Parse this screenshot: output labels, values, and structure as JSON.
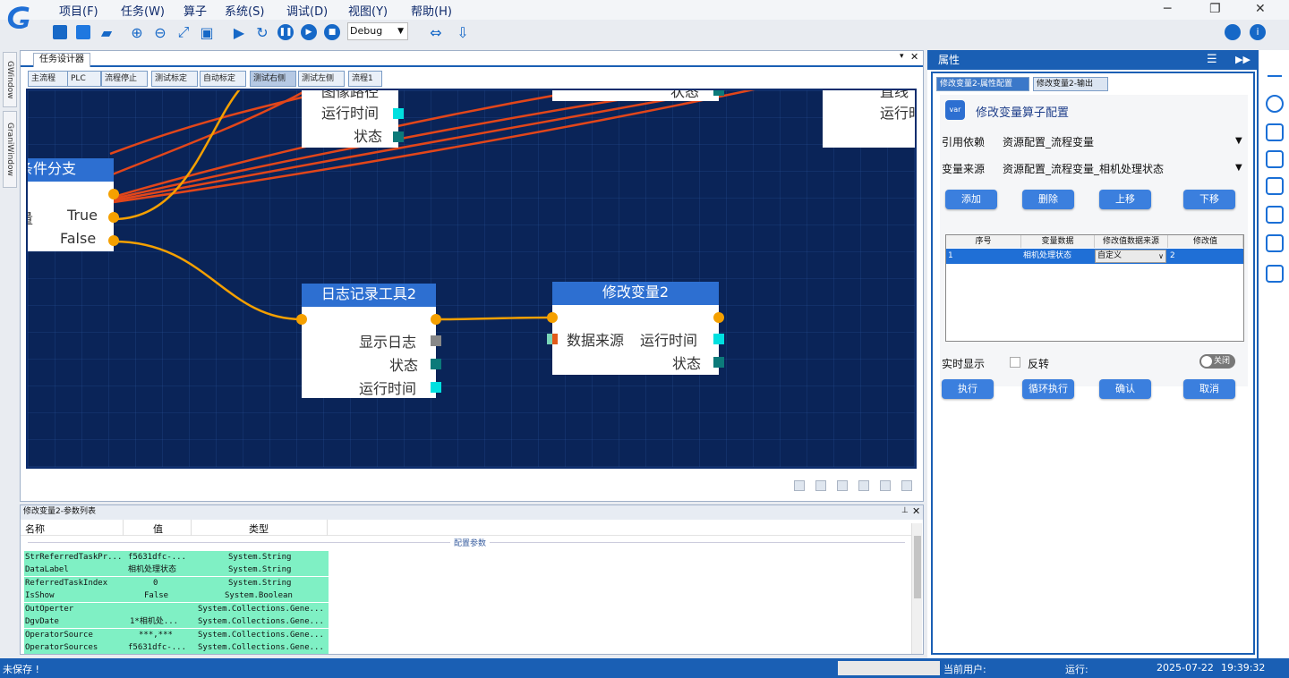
{
  "menu": {
    "items": [
      "项目(F)",
      "任务(W)",
      "算子",
      "系统(S)",
      "调试(D)",
      "视图(Y)",
      "帮助(H)"
    ]
  },
  "toolbar": {
    "mode_select": "Debug",
    "icons": [
      "save-icon",
      "new-icon",
      "open-icon",
      "zoom-in-icon",
      "zoom-out-icon",
      "fit-icon",
      "fullscreen-icon",
      "run-icon",
      "loop-icon",
      "pause-icon",
      "step-icon",
      "stop-icon",
      "left-right-icon",
      "download-icon"
    ]
  },
  "left_strip": {
    "tabs": [
      "GWindow",
      "GraniWindow"
    ]
  },
  "designer": {
    "tab": "任务设计器",
    "flow_tabs": [
      "主流程",
      "PLC",
      "流程停止",
      "测试标定",
      "自动标定",
      "测试右侧",
      "测试左侧",
      "流程1"
    ],
    "active_flow_tab": "测试右侧"
  },
  "nodes": {
    "top_left_partial": [
      "图像路径",
      "运行时间",
      "状态"
    ],
    "top_middle_partial": "状态",
    "top_right_partial": [
      "直线",
      "运行时"
    ],
    "branch": {
      "title": "条件分支",
      "var_label": "变量",
      "true_label": "True",
      "false_label": "False"
    },
    "log": {
      "title": "日志记录工具2",
      "ports": [
        "显示日志",
        "状态",
        "运行时间"
      ]
    },
    "modify": {
      "title": "修改变量2",
      "input": "数据来源",
      "outputs": [
        "运行时间",
        "状态"
      ]
    }
  },
  "params": {
    "title": "修改变量2-参数列表",
    "columns": [
      "名称",
      "值",
      "类型"
    ],
    "group_label": "配置参数",
    "rows": [
      {
        "name": "StrReferredTaskPr...",
        "value": "f5631dfc-...",
        "type": "System.String"
      },
      {
        "name": "DataLabel",
        "value": "相机处理状态",
        "type": "System.String"
      },
      {
        "name": "ReferredTaskIndex",
        "value": "0",
        "type": "System.String"
      },
      {
        "name": "IsShow",
        "value": "False",
        "type": "System.Boolean"
      },
      {
        "name": "OutOperter",
        "value": "",
        "type": "System.Collections.Gene..."
      },
      {
        "name": "DgvDate",
        "value": "1*相机处...",
        "type": "System.Collections.Gene..."
      },
      {
        "name": "OperatorSource",
        "value": "***,***",
        "type": "System.Collections.Gene..."
      },
      {
        "name": "OperatorSources",
        "value": "f5631dfc-...",
        "type": "System.Collections.Gene..."
      }
    ]
  },
  "properties": {
    "title": "属性",
    "tabs": [
      "修改变量2-属性配置",
      "修改变量2-输出"
    ],
    "config_title": "修改变量算子配置",
    "config_icon_text": "var",
    "ref_label": "引用依赖",
    "ref_value": "资源配置_流程变量",
    "source_label": "变量来源",
    "source_value": "资源配置_流程变量_相机处理状态",
    "buttons": {
      "add": "添加",
      "delete": "删除",
      "up": "上移",
      "down": "下移"
    },
    "grid_headers": [
      "序号",
      "变量数据",
      "修改值数据来源",
      "修改值"
    ],
    "grid_row": {
      "index": "1",
      "data": "相机处理状态",
      "source": "自定义",
      "value": "2"
    },
    "realtime_label": "实时显示",
    "invert_label": "反转",
    "toggle_label": "关闭",
    "actions": {
      "execute": "执行",
      "loop": "循环执行",
      "confirm": "确认",
      "cancel": "取消"
    }
  },
  "status": {
    "left": "未保存 !",
    "user_label": "当前用户:",
    "run_label": "运行:",
    "date": "2025-07-22",
    "time": "19:39:32"
  },
  "colors": {
    "accent": "#1a5fb4",
    "canvas": "#0a2458",
    "node_header": "#2d6fd1",
    "wire_orange": "#f5a000",
    "wire_red": "#e2461a",
    "param_row": "#7ff0c4"
  }
}
